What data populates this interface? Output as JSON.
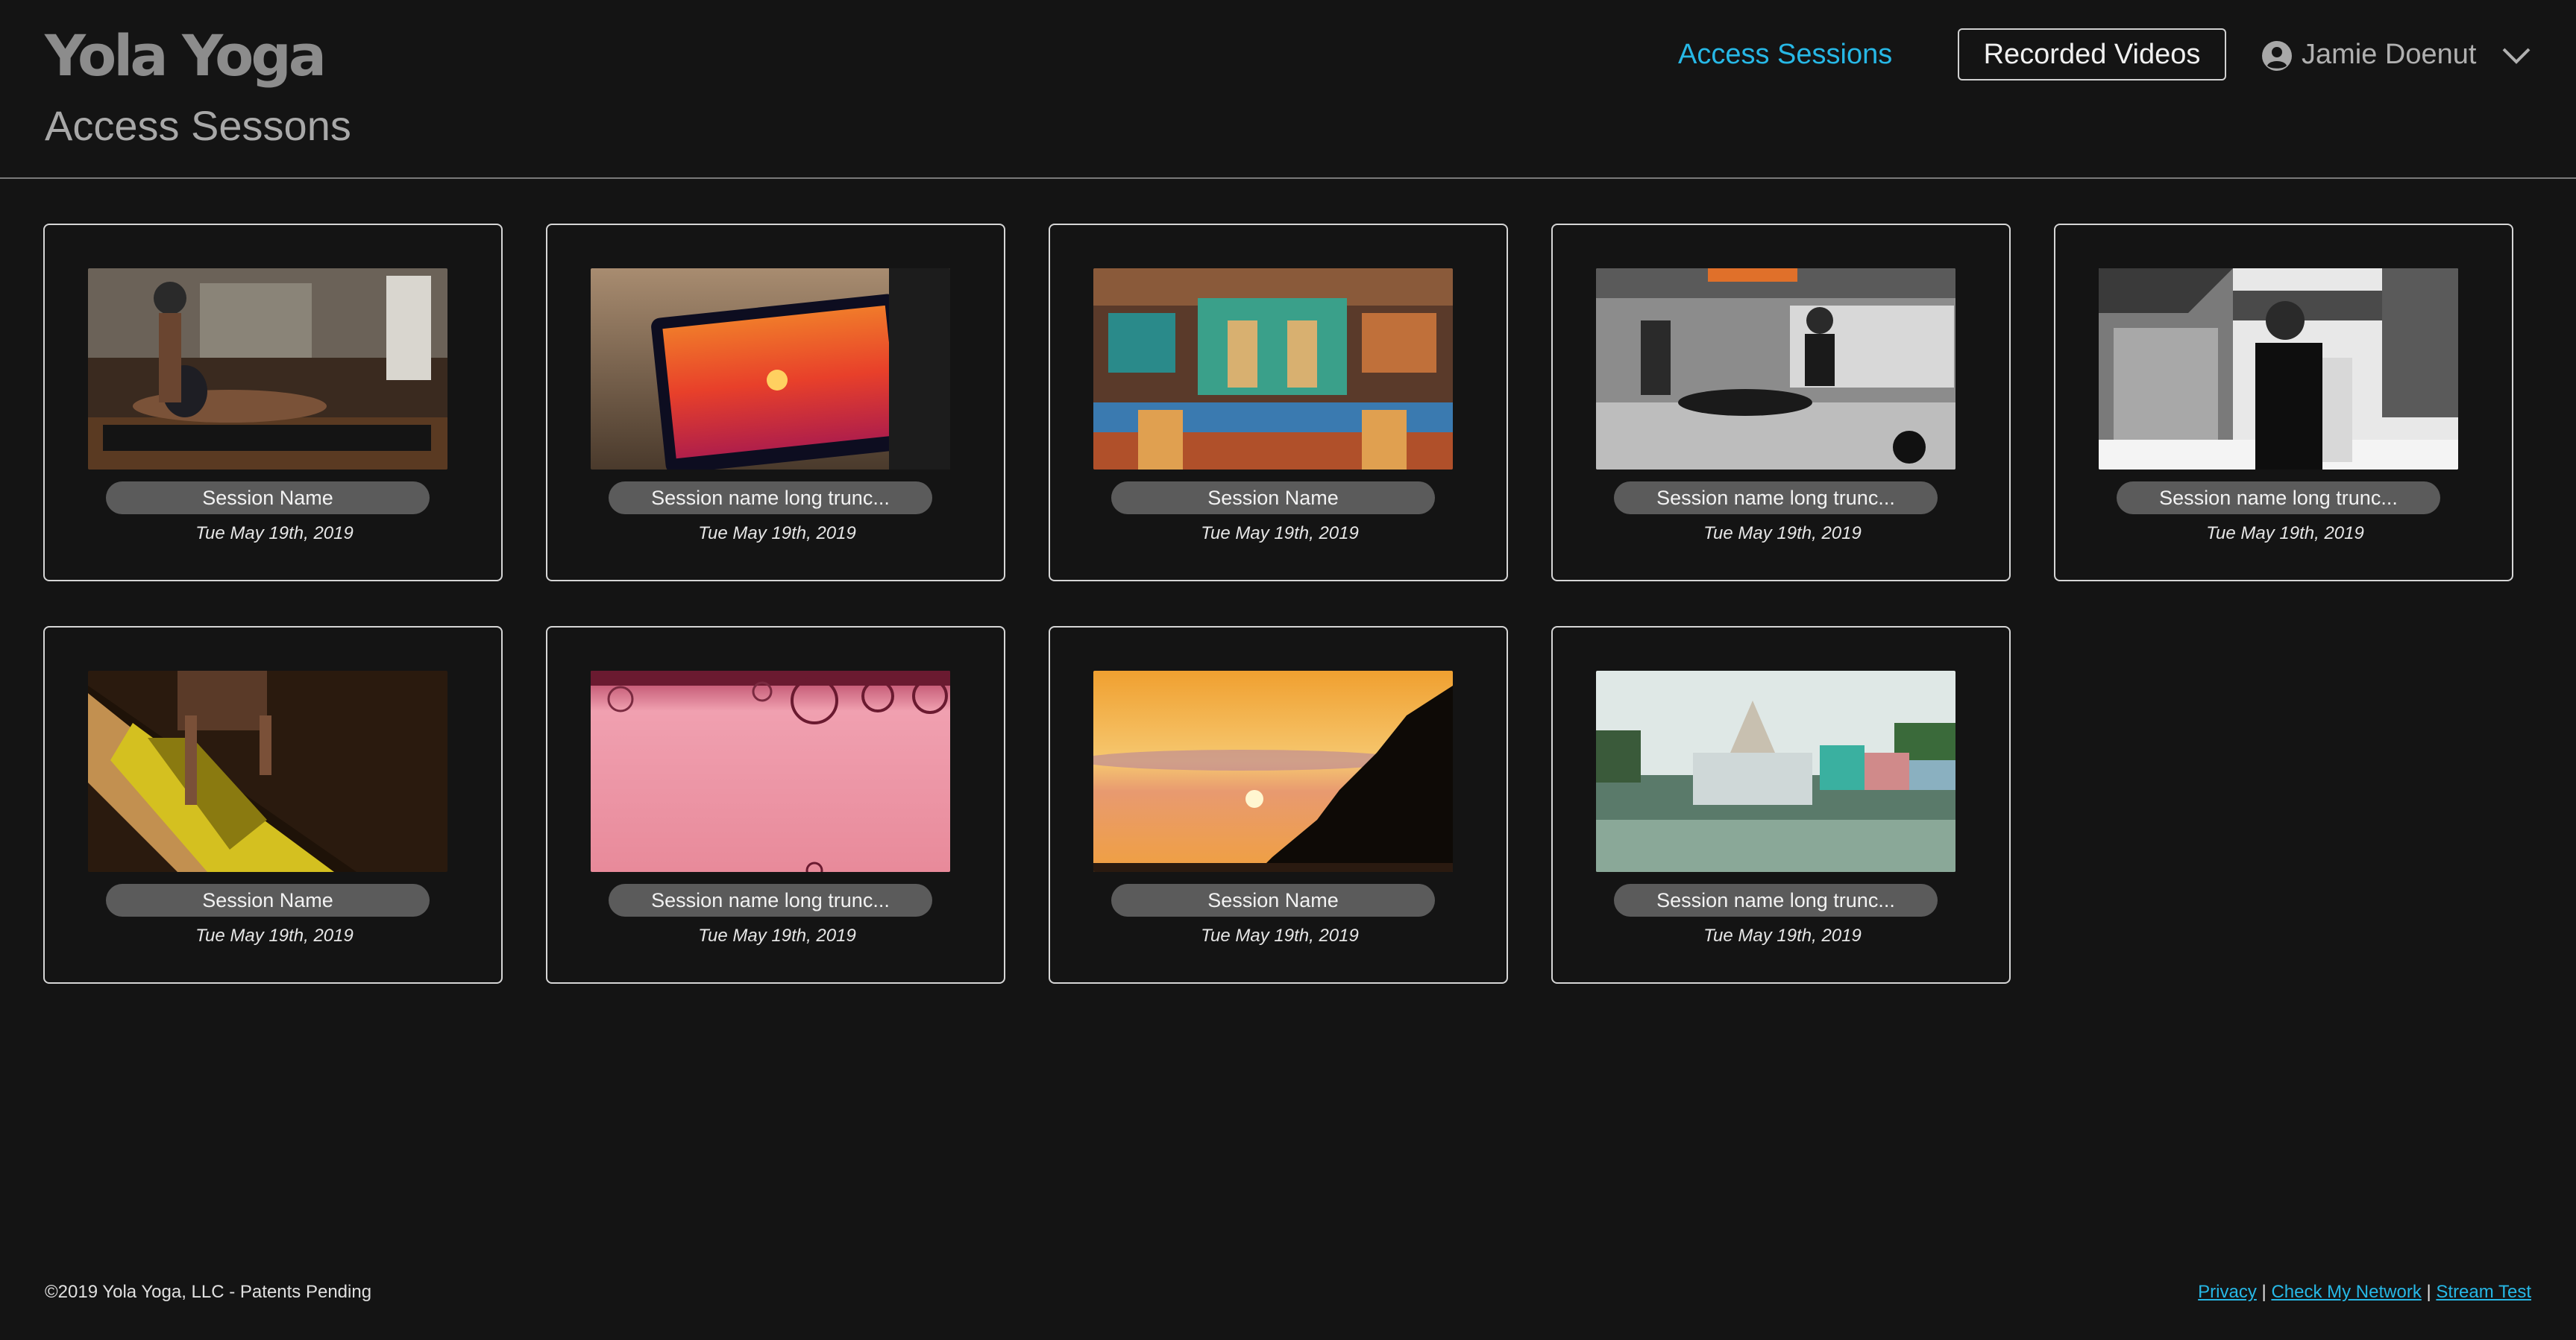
{
  "header": {
    "logo_text": "Yola Yoga",
    "page_subtitle": "Access Sessons",
    "nav_link_label": "Access Sessions",
    "nav_button_label": "Recorded Videos",
    "user_name": "Jamie Doenut",
    "accent_color": "#27b8e6"
  },
  "sessions": [
    {
      "name": "Session Name",
      "date": "Tue May 19th, 2019",
      "thumbnail": "yoga-cobra-pose"
    },
    {
      "name": "Session name long trunc...",
      "date": "Tue May 19th, 2019",
      "thumbnail": "camera-sunset-screen"
    },
    {
      "name": "Session Name",
      "date": "Tue May 19th, 2019",
      "thumbnail": "temple-sculptures"
    },
    {
      "name": "Session name long trunc...",
      "date": "Tue May 19th, 2019",
      "thumbnail": "gym-workout"
    },
    {
      "name": "Session name long trunc...",
      "date": "Tue May 19th, 2019",
      "thumbnail": "man-portrait"
    },
    {
      "name": "Session Name",
      "date": "Tue May 19th, 2019",
      "thumbnail": "yoga-yellow-mat"
    },
    {
      "name": "Session name long trunc...",
      "date": "Tue May 19th, 2019",
      "thumbnail": "pink-bubbles"
    },
    {
      "name": "Session Name",
      "date": "Tue May 19th, 2019",
      "thumbnail": "orange-sunset"
    },
    {
      "name": "Session name long trunc...",
      "date": "Tue May 19th, 2019",
      "thumbnail": "temple-waterfront"
    }
  ],
  "footer": {
    "copyright": "©2019 Yola Yoga, LLC - Patents Pending",
    "links": [
      {
        "label": "Privacy"
      },
      {
        "label": "Check My Network"
      },
      {
        "label": "Stream Test"
      }
    ],
    "separator": "|"
  }
}
